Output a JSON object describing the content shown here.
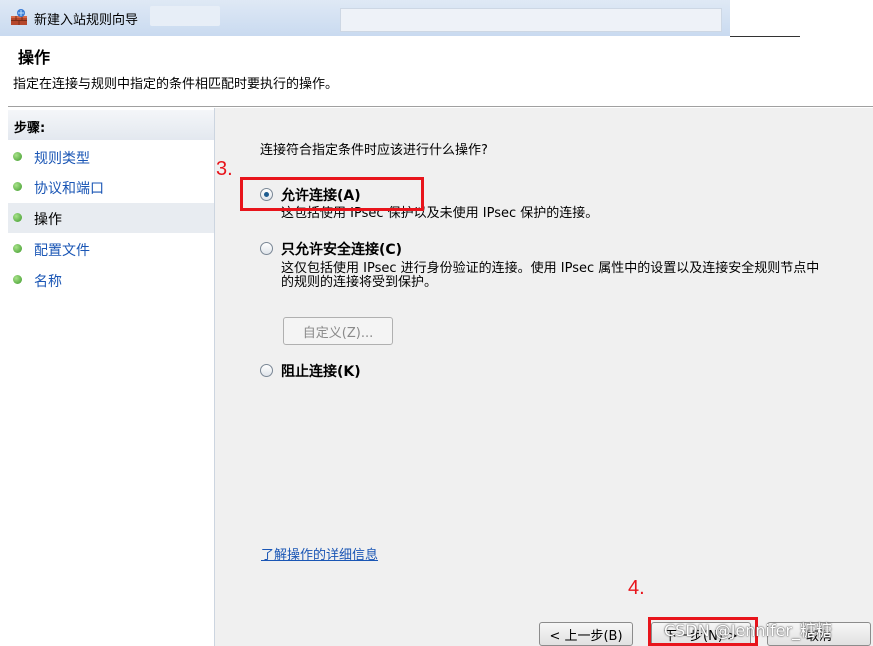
{
  "window": {
    "title": "新建入站规则向导",
    "icon": "firewall-icon"
  },
  "header": {
    "title": "操作",
    "description": "指定在连接与规则中指定的条件相匹配时要执行的操作。"
  },
  "sidebar": {
    "heading": "步骤:",
    "items": [
      {
        "label": "规则类型"
      },
      {
        "label": "协议和端口"
      },
      {
        "label": "操作",
        "current": true
      },
      {
        "label": "配置文件"
      },
      {
        "label": "名称"
      }
    ]
  },
  "main": {
    "question": "连接符合指定条件时应该进行什么操作?",
    "options": [
      {
        "label": "允许连接(A)",
        "description": "这包括使用 IPsec 保护以及未使用 IPsec 保护的连接。",
        "checked": true
      },
      {
        "label": "只允许安全连接(C)",
        "description": "这仅包括使用 IPsec 进行身份验证的连接。使用 IPsec 属性中的设置以及连接安全规则节点中的规则的连接将受到保护。",
        "checked": false
      },
      {
        "label": "阻止连接(K)",
        "description": "",
        "checked": false
      }
    ],
    "custom_button": "自定义(Z)...",
    "learn_more_link": "了解操作的详细信息"
  },
  "buttons": {
    "back": "< 上一步(B)",
    "next": "下一步(N) >",
    "cancel": "取消"
  },
  "annotations": {
    "step3": "3.",
    "step4": "4.",
    "color": "#e8141b"
  },
  "watermark": "CSDN @Jennifer_糖糖"
}
